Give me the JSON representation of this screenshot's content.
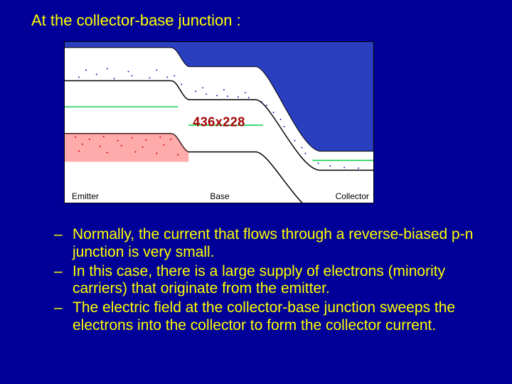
{
  "title": "At the collector-base junction :",
  "diagram": {
    "dimensions_label": "436x228",
    "labels": {
      "emitter": "Emitter",
      "base": "Base",
      "collector": "Collector"
    }
  },
  "chart_data": {
    "type": "diagram",
    "description": "Energy band diagram of a bipolar junction transistor showing Emitter, Base, and Collector regions. Emitter-base junction is forward biased (small barrier), collector-base junction is reverse biased (large band bending). Conduction band (top, blue filled) carries electrons (blue dots) injected from emitter through base into collector. Valence band (bottom, red) shows holes (red dots) on emitter side. Green horizontal lines indicate Fermi levels in each region.",
    "regions": [
      "Emitter",
      "Base",
      "Collector"
    ],
    "junctions": [
      {
        "name": "emitter-base",
        "bias": "forward"
      },
      {
        "name": "collector-base",
        "bias": "reverse"
      }
    ],
    "bands": [
      "conduction (blue)",
      "valence (red)"
    ],
    "carriers": [
      {
        "type": "electrons",
        "color": "blue",
        "flow": "emitter → base → collector"
      },
      {
        "type": "holes",
        "color": "red",
        "location": "emitter side"
      }
    ]
  },
  "bullets": [
    "Normally, the current that flows through a reverse-biased p-n junction is very small.",
    "In this case, there is a large supply of electrons (minority carriers) that originate from the emitter.",
    "The electric field at the collector-base junction sweeps the electrons into the collector to form the collector current."
  ]
}
